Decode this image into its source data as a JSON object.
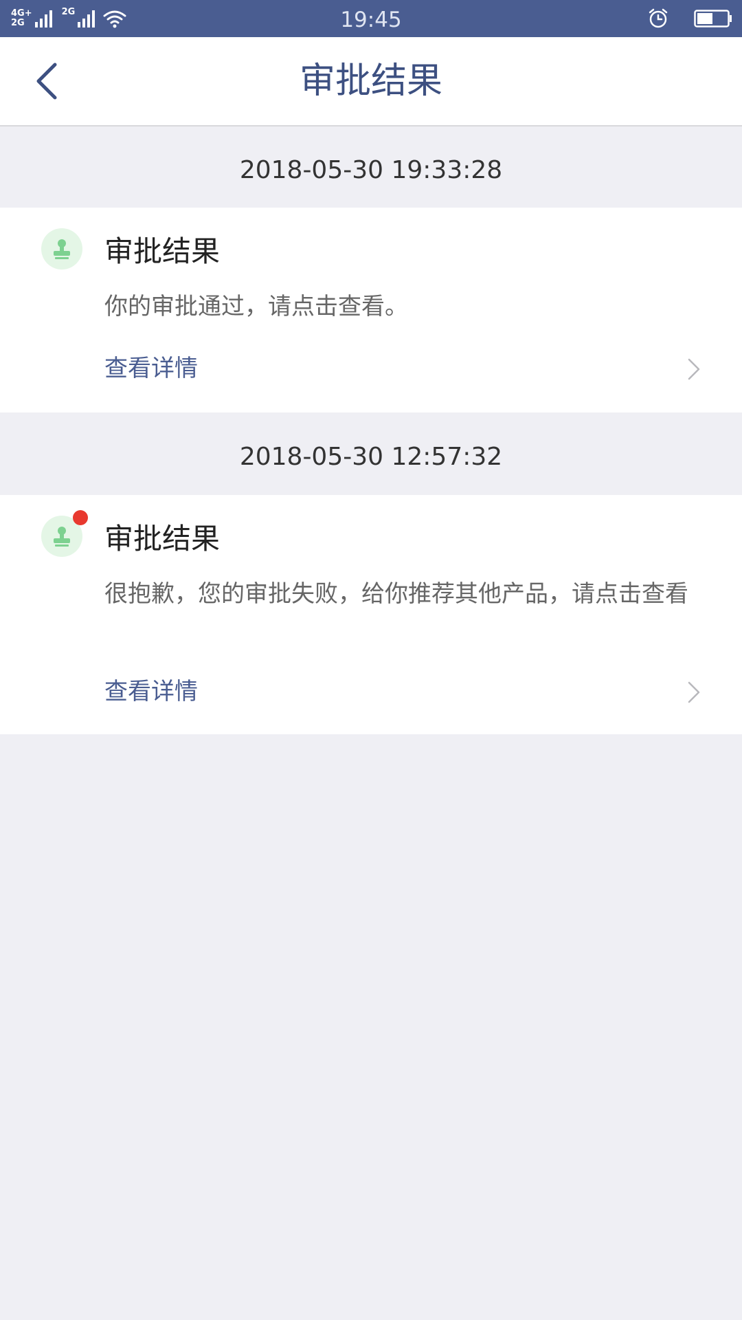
{
  "status_bar": {
    "network_top": "4G+",
    "network_bottom": "2G",
    "network_second": "2G",
    "time": "19:45",
    "icons": [
      "signal-icon",
      "wifi-icon",
      "alarm-icon",
      "battery-icon"
    ]
  },
  "nav": {
    "title": "审批结果",
    "back_icon": "chevron-left-icon"
  },
  "colors": {
    "status_bar_bg": "#4a5d91",
    "accent": "#4a5d91",
    "page_bg": "#efeff4",
    "unread_dot": "#e8392f",
    "avatar_bg": "#e4f6e6"
  },
  "messages": [
    {
      "date": "2018-05-30 19:33:28",
      "title": "审批结果",
      "body": "你的审批通过，请点击查看。",
      "link_label": "查看详情",
      "icon": "stamp-icon",
      "unread": false
    },
    {
      "date": "2018-05-30 12:57:32",
      "title": "审批结果",
      "body": "很抱歉，您的审批失败，给你推荐其他产品，请点击查看",
      "link_label": "查看详情",
      "icon": "stamp-icon",
      "unread": true
    }
  ]
}
